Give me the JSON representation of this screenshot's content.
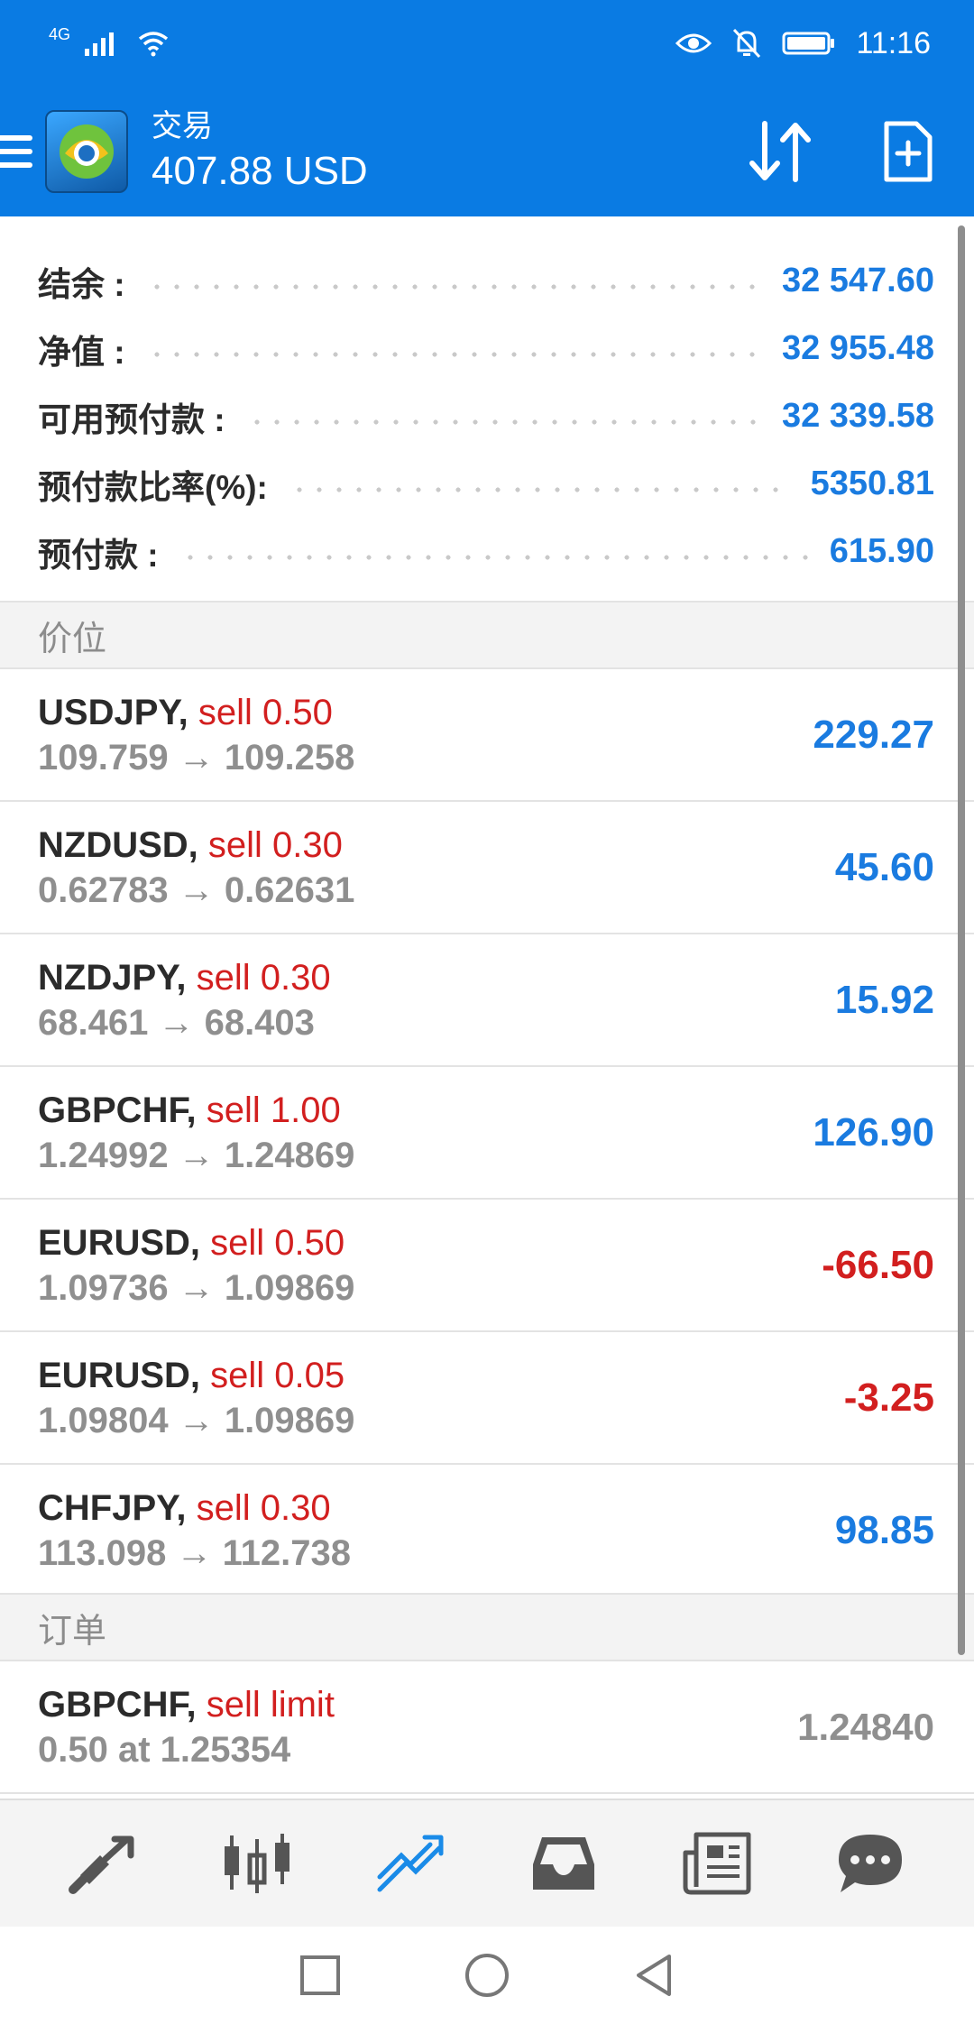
{
  "status": {
    "network": "4G",
    "time": "11:16"
  },
  "app_bar": {
    "title": "交易",
    "balance": "407.88 USD"
  },
  "summary": [
    {
      "label": "结余 :",
      "value": "32 547.60"
    },
    {
      "label": "净值 :",
      "value": "32 955.48"
    },
    {
      "label": "可用预付款 :",
      "value": "32 339.58"
    },
    {
      "label": "预付款比率(%):",
      "value": "5350.81"
    },
    {
      "label": "预付款 :",
      "value": "615.90"
    }
  ],
  "sections": {
    "positions_title": "价位",
    "orders_title": "订单"
  },
  "positions": [
    {
      "symbol": "USDJPY,",
      "action": "sell 0.50",
      "prices": "109.759 → 109.258",
      "profit": "229.27",
      "sign": "pos"
    },
    {
      "symbol": "NZDUSD,",
      "action": "sell 0.30",
      "prices": "0.62783 → 0.62631",
      "profit": "45.60",
      "sign": "pos"
    },
    {
      "symbol": "NZDJPY,",
      "action": "sell 0.30",
      "prices": "68.461 → 68.403",
      "profit": "15.92",
      "sign": "pos"
    },
    {
      "symbol": "GBPCHF,",
      "action": "sell 1.00",
      "prices": "1.24992 → 1.24869",
      "profit": "126.90",
      "sign": "pos"
    },
    {
      "symbol": "EURUSD,",
      "action": "sell 0.50",
      "prices": "1.09736 → 1.09869",
      "profit": "-66.50",
      "sign": "neg"
    },
    {
      "symbol": "EURUSD,",
      "action": "sell 0.05",
      "prices": "1.09804 → 1.09869",
      "profit": "-3.25",
      "sign": "neg"
    },
    {
      "symbol": "CHFJPY,",
      "action": "sell 0.30",
      "prices": "113.098 → 112.738",
      "profit": "98.85",
      "sign": "pos"
    }
  ],
  "orders": [
    {
      "symbol": "GBPCHF,",
      "action": "sell limit",
      "detail": "0.50 at 1.25354",
      "price": "1.24840"
    }
  ],
  "bottom_nav": [
    "quotes-icon",
    "chart-icon",
    "trade-icon",
    "history-icon",
    "news-icon",
    "chat-icon"
  ],
  "colors": {
    "brand": "#0a7be3",
    "positive": "#1a7be0",
    "negative": "#d21f1f",
    "muted": "#8f8f8f"
  }
}
